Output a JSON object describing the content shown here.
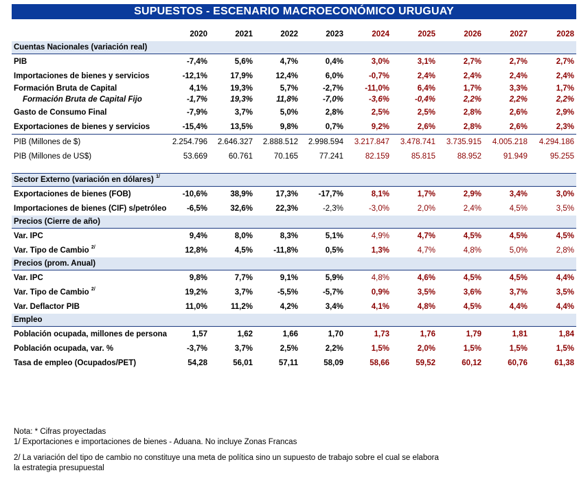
{
  "title": "SUPUESTOS - ESCENARIO MACROECONÓMICO URUGUAY",
  "years": [
    "2020",
    "2021",
    "2022",
    "2023",
    "2024",
    "2025",
    "2026",
    "2027",
    "2028"
  ],
  "projected_from_index": 4,
  "sections": [
    {
      "title": "Cuentas Nacionales (variación real)",
      "sup": "",
      "rows": [
        {
          "label": "PIB",
          "values": [
            "-7,4%",
            "5,6%",
            "4,7%",
            "0,4%",
            "3,0%",
            "3,1%",
            "2,7%",
            "2,7%",
            "2,7%"
          ],
          "style": "bold"
        },
        {
          "label": "Importaciones de bienes y servicios",
          "values": [
            "-12,1%",
            "17,9%",
            "12,4%",
            "6,0%",
            "-0,7%",
            "2,4%",
            "2,4%",
            "2,4%",
            "2,4%"
          ],
          "style": "bold"
        },
        {
          "label": "Formación Bruta de Capital",
          "values": [
            "4,1%",
            "19,3%",
            "5,7%",
            "-2,7%",
            "-11,0%",
            "6,4%",
            "1,7%",
            "3,3%",
            "1,7%"
          ],
          "style": "bold",
          "compact": true
        },
        {
          "label": "Formación Bruta de Capital Fijo",
          "values": [
            "-1,7%",
            "19,3%",
            "11,8%",
            "-7,0%",
            "-3,6%",
            "-0,4%",
            "2,2%",
            "2,2%",
            "2,2%"
          ],
          "style": "italic",
          "compact": true
        },
        {
          "label": "Gasto de Consumo Final",
          "values": [
            "-7,9%",
            "3,7%",
            "5,0%",
            "2,8%",
            "2,5%",
            "2,5%",
            "2,8%",
            "2,6%",
            "2,9%"
          ],
          "style": "bold"
        },
        {
          "label": "Exportaciones de bienes y servicios",
          "values": [
            "-15,4%",
            "13,5%",
            "9,8%",
            "0,7%",
            "9,2%",
            "2,6%",
            "2,8%",
            "2,6%",
            "2,3%"
          ],
          "style": "bold"
        }
      ],
      "extra_rows": [
        {
          "label": "PIB (Millones de $)",
          "values": [
            "2.254.796",
            "2.646.327",
            "2.888.512",
            "2.998.594",
            "3.217.847",
            "3.478.741",
            "3.735.915",
            "4.005.218",
            "4.294.186"
          ],
          "style": "normal"
        },
        {
          "label": "PIB (Millones de US$)",
          "values": [
            "53.669",
            "60.761",
            "70.165",
            "77.241",
            "82.159",
            "85.815",
            "88.952",
            "91.949",
            "95.255"
          ],
          "style": "normal"
        }
      ]
    },
    {
      "title": "Sector Externo (variación en dólares)",
      "sup": "1/",
      "rows": [
        {
          "label": "Exportaciones de bienes (FOB)",
          "values": [
            "-10,6%",
            "38,9%",
            "17,3%",
            "-17,7%",
            "8,1%",
            "1,7%",
            "2,9%",
            "3,4%",
            "3,0%"
          ],
          "style": "bold"
        },
        {
          "label": "Importaciones de bienes (CIF) s/petróleo",
          "values": [
            "-6,5%",
            "32,6%",
            "22,3%",
            "-2,3%",
            "-3,0%",
            "2,0%",
            "2,4%",
            "4,5%",
            "3,5%"
          ],
          "style": "bold",
          "normal_from": 3
        }
      ]
    },
    {
      "title": "Precios (Cierre de año)",
      "sup": "",
      "rows": [
        {
          "label": "Var. IPC",
          "values": [
            "9,4%",
            "8,0%",
            "8,3%",
            "5,1%",
            "4,9%",
            "4,7%",
            "4,5%",
            "4,5%",
            "4,5%"
          ],
          "style": "bold",
          "normal_from": 4,
          "normal_to": 4
        },
        {
          "label": "Var. Tipo de Cambio",
          "sup": "2/",
          "values": [
            "12,8%",
            "4,5%",
            "-11,8%",
            "0,5%",
            "1,3%",
            "4,7%",
            "4,8%",
            "5,0%",
            "2,8%"
          ],
          "style": "bold",
          "normal_from": 5
        }
      ]
    },
    {
      "title": "Precios (prom. Anual)",
      "sup": "",
      "rows": [
        {
          "label": "Var. IPC",
          "values": [
            "9,8%",
            "7,7%",
            "9,1%",
            "5,9%",
            "4,8%",
            "4,6%",
            "4,5%",
            "4,5%",
            "4,4%"
          ],
          "style": "bold",
          "normal_from": 4,
          "normal_to": 4
        },
        {
          "label": "Var. Tipo de Cambio",
          "sup": "2/",
          "values": [
            "19,2%",
            "3,7%",
            "-5,5%",
            "-5,7%",
            "0,9%",
            "3,5%",
            "3,6%",
            "3,7%",
            "3,5%"
          ],
          "style": "bold"
        },
        {
          "label": "Var. Deflactor PIB",
          "values": [
            "11,0%",
            "11,2%",
            "4,2%",
            "3,4%",
            "4,1%",
            "4,8%",
            "4,5%",
            "4,4%",
            "4,4%"
          ],
          "style": "bold"
        }
      ]
    },
    {
      "title": "Empleo",
      "sup": "",
      "rows": [
        {
          "label": "Población ocupada, millones de persona",
          "values": [
            "1,57",
            "1,62",
            "1,66",
            "1,70",
            "1,73",
            "1,76",
            "1,79",
            "1,81",
            "1,84"
          ],
          "style": "bold"
        },
        {
          "label": "Población ocupada, var. %",
          "values": [
            "-3,7%",
            "3,7%",
            "2,5%",
            "2,2%",
            "1,5%",
            "2,0%",
            "1,5%",
            "1,5%",
            "1,5%"
          ],
          "style": "bold"
        },
        {
          "label": "Tasa de empleo (Ocupados/PET)",
          "values": [
            "54,28",
            "56,01",
            "57,11",
            "58,09",
            "58,66",
            "59,52",
            "60,12",
            "60,76",
            "61,38"
          ],
          "style": "bold"
        }
      ]
    }
  ],
  "notes": [
    "Nota: * Cifras proyectadas",
    "1/ Exportaciones e importaciones de bienes - Aduana. No incluye Zonas Francas",
    "2/ La variación del tipo de cambio no constituye una meta de política sino un supuesto de trabajo sobre el cual se elabora",
    "la estrategia presupuestal"
  ],
  "colors": {
    "banner": "#0b3b9c",
    "section_fill": "#dde6f3",
    "projected": "#8b0000"
  }
}
